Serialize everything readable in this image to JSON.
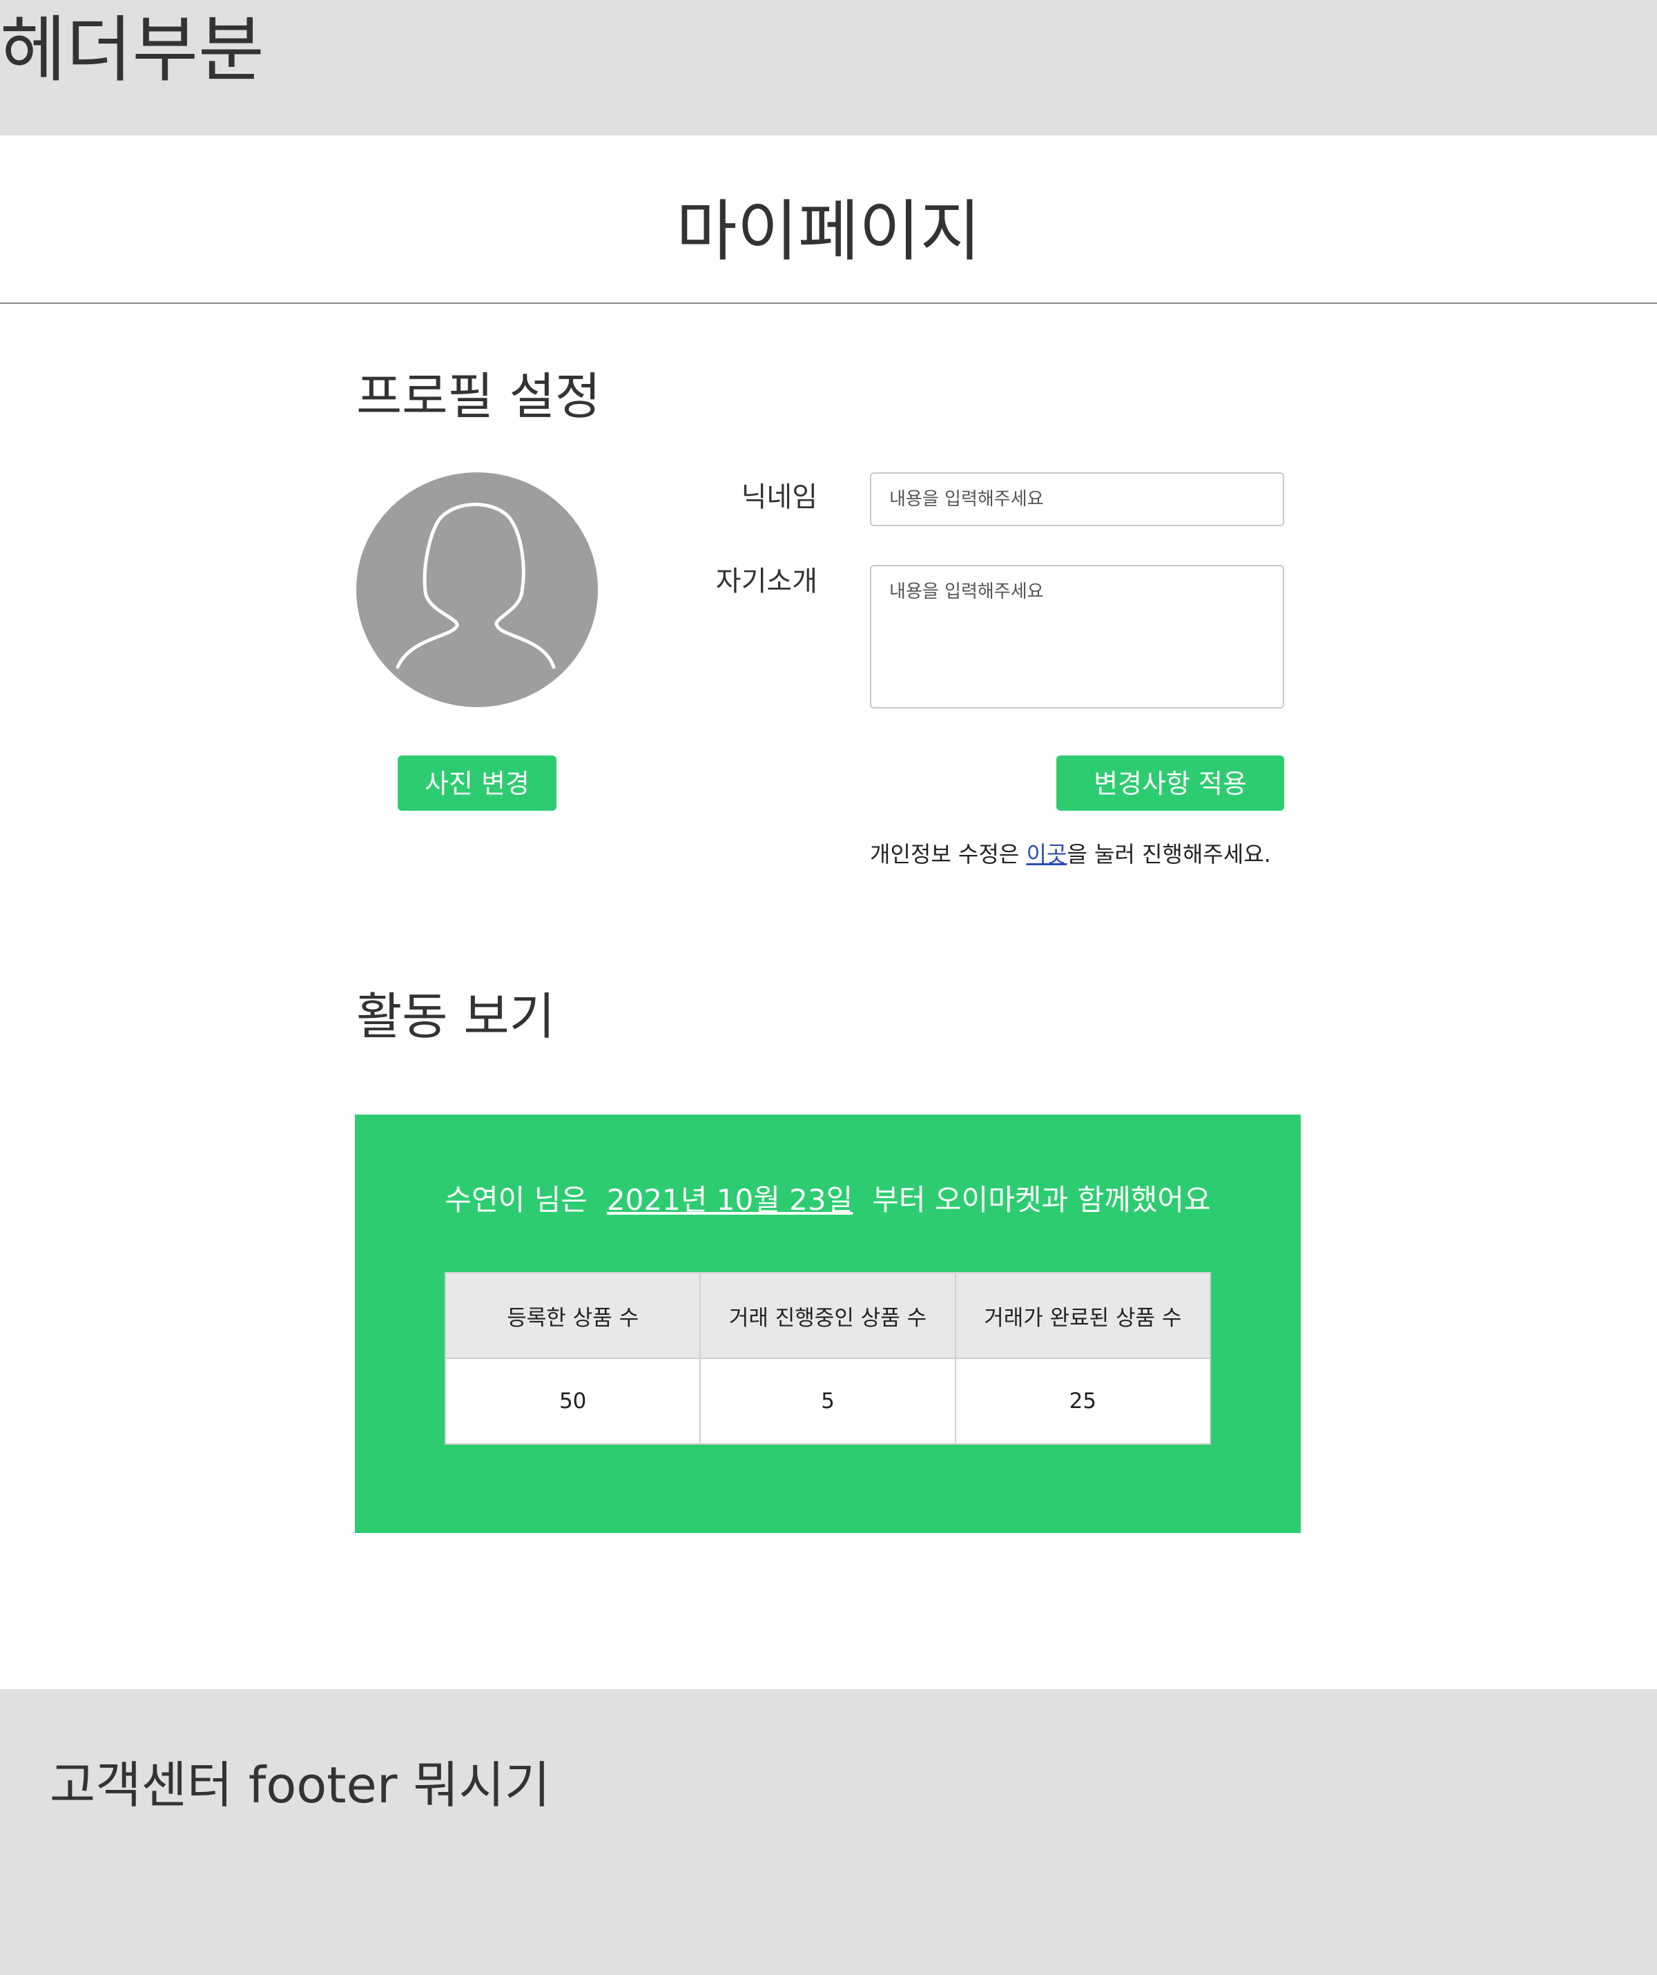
{
  "header": {
    "title": "헤더부분"
  },
  "page": {
    "title": "마이페이지"
  },
  "profile": {
    "heading": "프로필 설정",
    "photo_button": "사진 변경",
    "nickname_label": "닉네임",
    "nickname_placeholder": "내용을 입력해주세요",
    "intro_label": "자기소개",
    "intro_placeholder": "내용을 입력해주세요",
    "apply_button": "변경사항 적용",
    "privacy_prefix": "개인정보 수정은 ",
    "privacy_link": "이곳",
    "privacy_suffix": "을 눌러 진행해주세요.",
    "avatar_icon": "user-silhouette-icon"
  },
  "activity": {
    "heading": "활동 보기",
    "summary_prefix": "수연이 님은",
    "summary_date": "2021년 10월 23일",
    "summary_suffix": "부터 오이마켓과 함께했어요",
    "columns": [
      "등록한 상품 수",
      "거래 진행중인 상품 수",
      "거래가 완료된 상품 수"
    ],
    "values": [
      "50",
      "5",
      "25"
    ]
  },
  "footer": {
    "text": "고객센터 footer 뭐시기"
  },
  "colors": {
    "accent": "#2ecc71",
    "header_bg": "#e0e0e0",
    "avatar_bg": "#9e9e9e",
    "link": "#2a4db5"
  }
}
